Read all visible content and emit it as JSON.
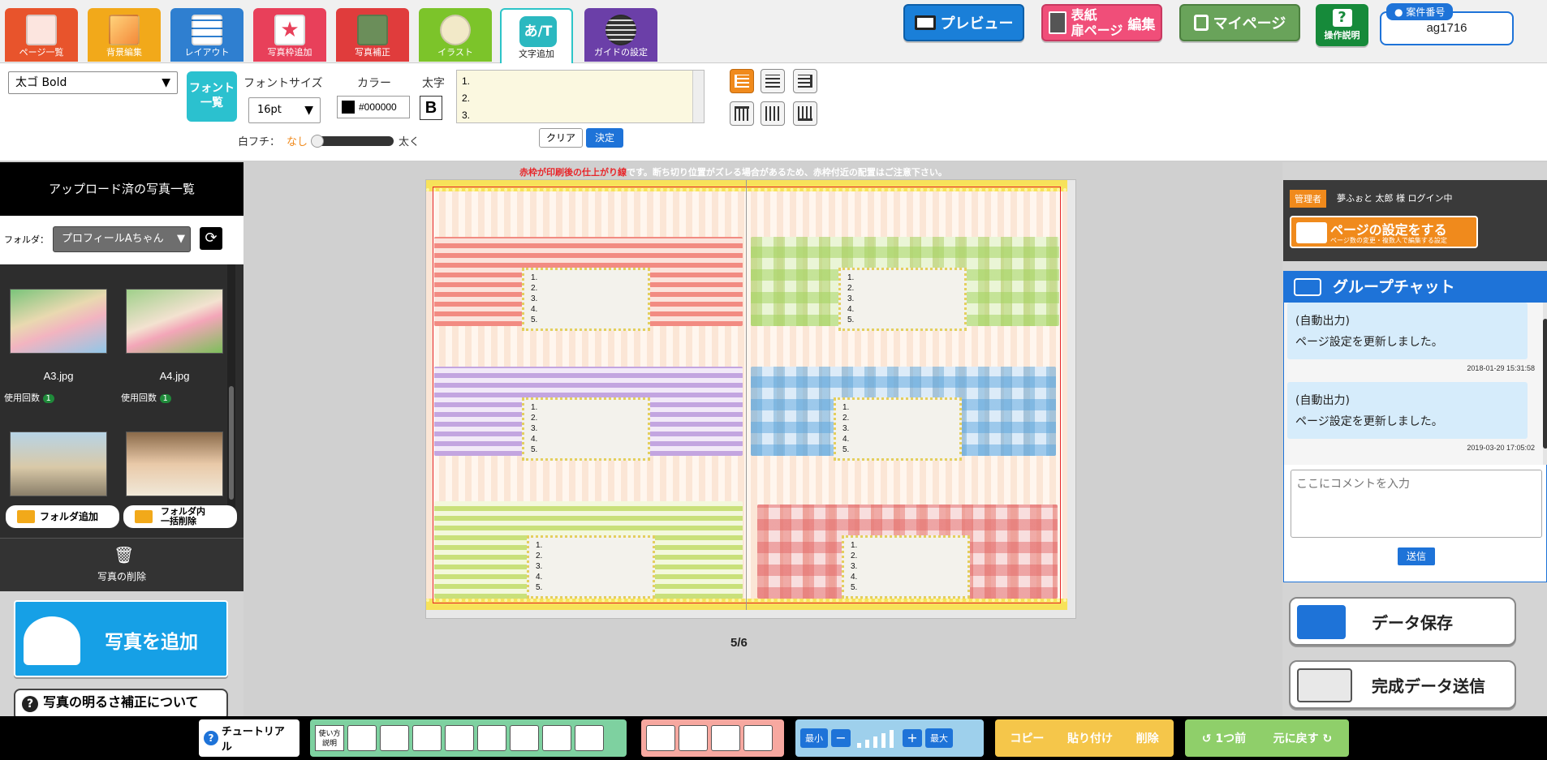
{
  "nav": {
    "tabs": [
      {
        "label": "ページ一覧",
        "color": "#e8542c"
      },
      {
        "label": "背景編集",
        "color": "#f2a91a"
      },
      {
        "label": "レイアウト",
        "color": "#2f7fd0"
      },
      {
        "label": "写真枠追加",
        "color": "#e8405a"
      },
      {
        "label": "写真補正",
        "color": "#e03c3c"
      },
      {
        "label": "イラスト",
        "color": "#7cc42a"
      },
      {
        "label": "文字追加",
        "icon_text": "あ/T"
      },
      {
        "label": "ガイドの設定",
        "color": "#6b3fa8"
      }
    ],
    "preview_label": "プレビュー",
    "cover_label_line1": "表紙",
    "cover_label_line2": "扉ページ",
    "cover_edit_label": "編集",
    "mypage_label": "マイページ",
    "help_label": "操作説明",
    "case_number_label": "案件番号",
    "case_number_value": "ag1716"
  },
  "toolbar": {
    "font_value": "太ゴ Bold",
    "font_list_label_1": "フォント",
    "font_list_label_2": "一覧",
    "font_size_label": "フォントサイズ",
    "font_size_value": "16pt",
    "color_label": "カラー",
    "color_value": "#000000",
    "bold_label": "太字",
    "bold_glyph": "B",
    "outline_label": "白フチ：",
    "outline_none": "なし",
    "outline_thick": "太く",
    "text_lines": [
      "1.",
      "2.",
      "3."
    ],
    "clear_label": "クリア",
    "apply_label": "決定"
  },
  "left": {
    "title": "アップロード済の写真一覧",
    "folder_label": "フォルダ：",
    "folder_value": "プロフィールAちゃん",
    "photos": [
      {
        "name": "A3.jpg",
        "usage_label": "使用回数",
        "usage_count": "1"
      },
      {
        "name": "A4.jpg",
        "usage_label": "使用回数",
        "usage_count": "1"
      }
    ],
    "add_folder_label": "フォルダ追加",
    "delete_all_label_1": "フォルダ内",
    "delete_all_label_2": "一括削除",
    "delete_photo_label": "写真の削除",
    "add_photo_label": "写真を追加",
    "brightness_label": "写真の明るさ補正について"
  },
  "canvas": {
    "notice_red": "赤枠が印刷後の仕上がり線",
    "notice_rest": "です。断ち切り位置がズレる場合があるため、赤枠付近の配置はご注意下さい。",
    "page_indicator": "5/6",
    "note_lines": [
      "1.",
      "2.",
      "3.",
      "4.",
      "5."
    ]
  },
  "right": {
    "admin_badge": "管理者",
    "login_text": "夢ふぉと 太郎 様 ログイン中",
    "page_settings_label": "ページの設定をする",
    "page_settings_sub": "ページ数の変更・複数人で編集する設定",
    "chat_title": "グループチャット",
    "messages": [
      {
        "line1": "(自動出力)",
        "line2": "ページ設定を更新しました。",
        "time": "2018-01-29 15:31:58"
      },
      {
        "line1": "(自動出力)",
        "line2": "ページ設定を更新しました。",
        "time": "2019-03-20 17:05:02"
      }
    ],
    "comment_placeholder": "ここにコメントを入力",
    "send_label": "送信",
    "save_label": "データ保存",
    "submit_label": "完成データ送信"
  },
  "bottom": {
    "tutorial_label": "チュートリアル",
    "usage_label_1": "使い方",
    "usage_label_2": "説明",
    "zoom_min": "最小",
    "zoom_max": "最大",
    "copy_label": "コピー",
    "paste_label": "貼り付け",
    "delete_label": "削除",
    "undo_label": "1つ前",
    "redo_label": "元に戻す"
  },
  "colors": {
    "accent_teal": "#2bb8c0",
    "chat_blue": "#1e73d8",
    "orange": "#f08a1c"
  }
}
